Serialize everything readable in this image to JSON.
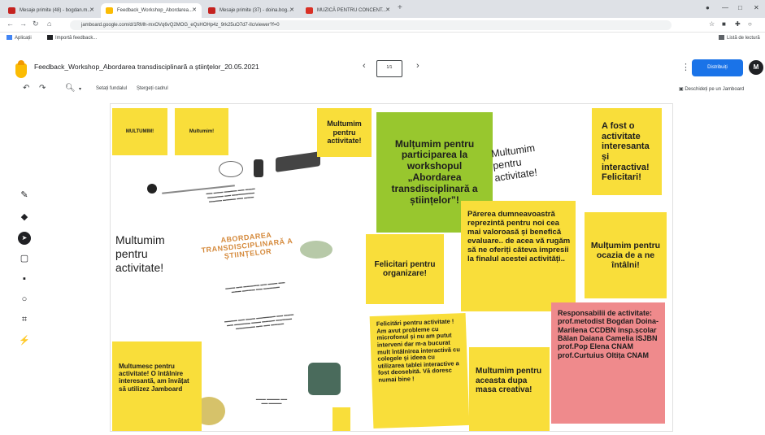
{
  "browser": {
    "tabs": [
      {
        "label": "Mesaje primite (48) - bogdan.m...",
        "active": false,
        "color": "#c5221f"
      },
      {
        "label": "Feedback_Workshop_Abordarea...",
        "active": true,
        "color": "#fbbc04"
      },
      {
        "label": "Mesaje primite (37) - doina.bog...",
        "active": false,
        "color": "#c5221f"
      },
      {
        "label": "MUZICĂ PENTRU CONCENT...",
        "active": false,
        "color": "#d93025"
      }
    ],
    "new_tab": "+",
    "url": "jamboard.google.com/d/1RMh-mxOVq6vQ2MOG_eQsHOHp4z_9rk25uO7d7-Ilc/viewer?f=0",
    "bookmarks": [
      {
        "label": "Aplicații",
        "color": "#4285f4"
      },
      {
        "label": "Importă feedback...",
        "color": "#202124"
      }
    ],
    "reading_list": "Listă de lectură"
  },
  "app": {
    "title": "Feedback_Workshop_Abordarea transdisciplinară a științelor_20.05.2021",
    "frame_indicator": "1/1",
    "share_label": "Distribuiți",
    "avatar_letter": "M",
    "toolbar": {
      "set_background": "Setați fundalul",
      "clear_frame": "Ștergeți cadrul"
    },
    "open_in_jamboard": "Deschideți pe un Jamboard"
  },
  "tools": [
    "pen-icon",
    "eraser-icon",
    "select-icon",
    "sticky-note-icon",
    "image-icon",
    "shape-icon",
    "textbox-icon",
    "laser-icon"
  ],
  "notes": {
    "n1": "MULTUMIM!",
    "n2": "Multumim!",
    "n3": "Multumim pentru activitate!",
    "n4": "Mulțumim pentru participarea la workshopul „Abordarea transdisciplinară a științelor”!",
    "n5": "Multumim pentru activitate!",
    "n6": "A fost o activitate interesanta și interactiva! Felicitari!",
    "n7": "Multumim pentru activitate!",
    "n8": "Felicitari pentru organizare!",
    "n9": "Părerea dumneavoastră reprezintă pentru noi cea mai valoroasă și benefică evaluare.. de acea vă rugăm să ne oferiți câteva impresii la finalul acestei activități..",
    "n10": "Mulțumim pentru ocazia de a ne întâlni!",
    "n11": "Responsabilii de activitate: prof.metodist Bogdan Doina-Marilena CCDBN insp.școlar Bălan Daiana Camelia ISJBN prof.Pop Elena CNAM prof.Curtuius Oltița CNAM",
    "n12": "Felicitări pentru activitate ! Am avut probleme cu microfonul și nu am putut interveni dar m-a bucurat mult întâlnirea interactivă cu colegele și ideea cu utilizarea tablei interactive a fost deosebită. Vă doresc numai bine !",
    "n13": "Multumim pentru aceasta dupa masa creativa!",
    "n14": "Multumesc pentru activitate! O întâlnire interesantă, am învățat să utilizez Jamboard"
  },
  "poster": {
    "title": "ABORDAREA TRANSDISCIPLINARĂ A ȘTIINȚELOR"
  },
  "colors": {
    "sticky_yellow": "#f9de3a",
    "sticky_green": "#98c72e",
    "sticky_pink": "#ef8a8c",
    "share_blue": "#1a73e8"
  }
}
